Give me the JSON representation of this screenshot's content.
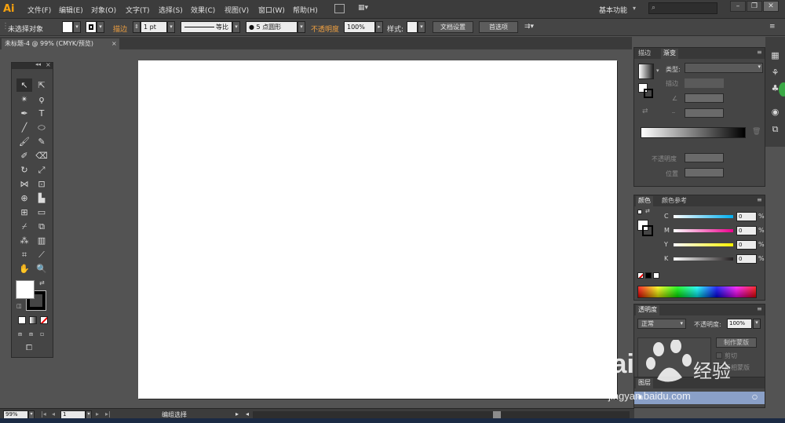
{
  "app": {
    "logo": "Ai"
  },
  "menu": [
    "文件(F)",
    "编辑(E)",
    "对象(O)",
    "文字(T)",
    "选择(S)",
    "效果(C)",
    "视图(V)",
    "窗口(W)",
    "帮助(H)"
  ],
  "workspace": {
    "label": "基本功能"
  },
  "control_bar": {
    "selection_status": "未选择对象",
    "stroke_label": "描边",
    "stroke_weight": "1 pt",
    "stroke_profile": "等比",
    "brush": "5 点圆形",
    "opacity_label": "不透明度",
    "opacity_value": "100%",
    "style_label": "样式:",
    "doc_setup_button": "文档设置",
    "preferences_button": "首选项"
  },
  "document": {
    "tab_title": "未标题-4 @ 99% (CMYK/预览)"
  },
  "gradient_panel": {
    "tabs": [
      "描边",
      "渐变"
    ],
    "type_label": "类型:",
    "stroke_label": "描边",
    "opacity_label": "不透明度",
    "position_label": "位置"
  },
  "color_panel": {
    "tabs": [
      "颜色",
      "颜色参考"
    ],
    "channels": [
      {
        "name": "C",
        "value": "0",
        "unit": "%"
      },
      {
        "name": "M",
        "value": "0",
        "unit": "%"
      },
      {
        "name": "Y",
        "value": "0",
        "unit": "%"
      },
      {
        "name": "K",
        "value": "0",
        "unit": "%"
      }
    ]
  },
  "transparency_panel": {
    "tab": "透明度",
    "blend_mode": "正常",
    "opacity_label": "不透明度:",
    "opacity_value": "100%",
    "make_mask_button": "制作蒙版",
    "clip_label": "剪切",
    "invert_label": "反相蒙版"
  },
  "layers_panel": {
    "tab": "图层"
  },
  "status_bar": {
    "zoom": "99%",
    "artboard_number": "1",
    "status_text": "编组选择"
  },
  "watermark": {
    "brand": "Bai",
    "brand_suffix": "经验",
    "url": "jingyan.baidu.com"
  },
  "colors": {
    "app_bg": "#535353",
    "panel_bg": "#454545",
    "accent_orange": "#f0a040",
    "cyan": "#00aeef",
    "magenta": "#ec008c",
    "yellow": "#fff200",
    "black": "#231f20"
  }
}
